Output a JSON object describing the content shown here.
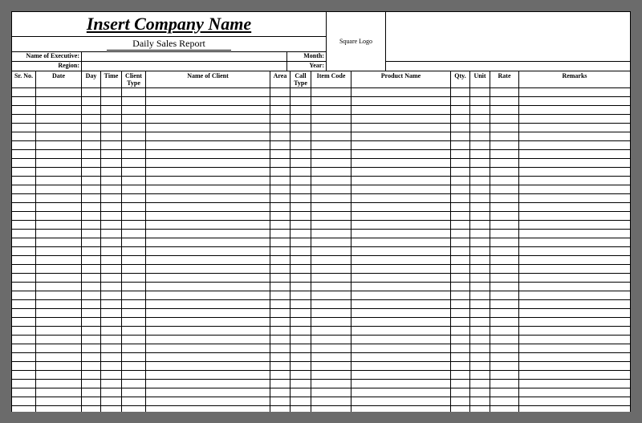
{
  "header": {
    "company_name": "Insert Company Name",
    "subtitle": "Daily Sales Report",
    "logo_placeholder": "Square Logo"
  },
  "meta": {
    "executive_label": "Name of Executive:",
    "executive_value": "",
    "month_label": "Month:",
    "month_value": "",
    "region_label": "Region:",
    "region_value": "",
    "year_label": "Year:",
    "year_value": ""
  },
  "columns": {
    "sr": "Sr. No.",
    "date": "Date",
    "day": "Day",
    "time": "Time",
    "client_type": "Client Type",
    "client_name": "Name of Client",
    "area": "Area",
    "call_type": "Call Type",
    "item_code": "Item Code",
    "product_name": "Product Name",
    "qty": "Qty.",
    "unit": "Unit",
    "rate": "Rate",
    "remarks": "Remarks"
  },
  "row_count": 38
}
